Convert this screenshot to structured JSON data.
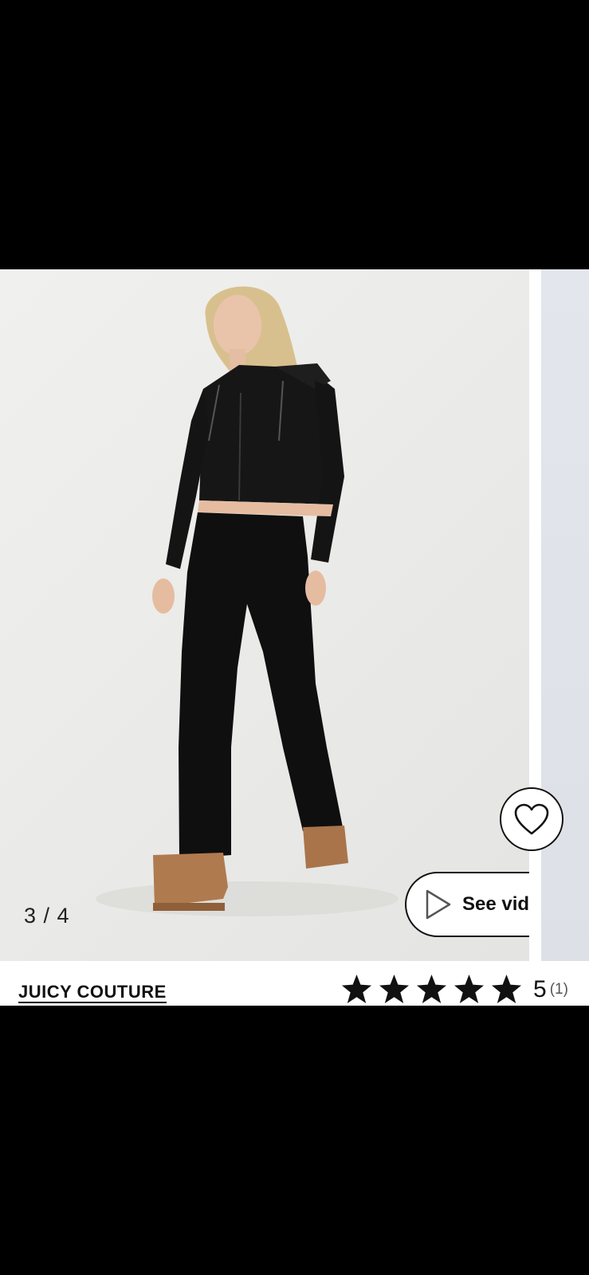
{
  "gallery": {
    "counter": "3 / 4",
    "video_label": "See video",
    "favorite_icon": "heart-outline-icon",
    "play_icon": "play-outline-icon"
  },
  "product": {
    "brand": "JUICY COUTURE",
    "rating": {
      "score": "5",
      "count": "(1)",
      "stars_filled": 5,
      "stars_total": 5
    }
  },
  "colors": {
    "text": "#111111",
    "background": "#ffffff",
    "system_bars": "#000000"
  }
}
